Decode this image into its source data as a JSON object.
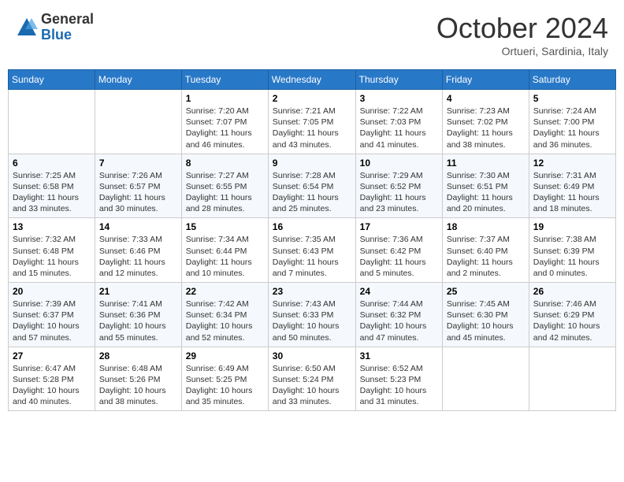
{
  "header": {
    "logo_general": "General",
    "logo_blue": "Blue",
    "month_title": "October 2024",
    "location": "Ortueri, Sardinia, Italy"
  },
  "days_of_week": [
    "Sunday",
    "Monday",
    "Tuesday",
    "Wednesday",
    "Thursday",
    "Friday",
    "Saturday"
  ],
  "weeks": [
    [
      {
        "day": "",
        "sunrise": "",
        "sunset": "",
        "daylight": ""
      },
      {
        "day": "",
        "sunrise": "",
        "sunset": "",
        "daylight": ""
      },
      {
        "day": "1",
        "sunrise": "Sunrise: 7:20 AM",
        "sunset": "Sunset: 7:07 PM",
        "daylight": "Daylight: 11 hours and 46 minutes."
      },
      {
        "day": "2",
        "sunrise": "Sunrise: 7:21 AM",
        "sunset": "Sunset: 7:05 PM",
        "daylight": "Daylight: 11 hours and 43 minutes."
      },
      {
        "day": "3",
        "sunrise": "Sunrise: 7:22 AM",
        "sunset": "Sunset: 7:03 PM",
        "daylight": "Daylight: 11 hours and 41 minutes."
      },
      {
        "day": "4",
        "sunrise": "Sunrise: 7:23 AM",
        "sunset": "Sunset: 7:02 PM",
        "daylight": "Daylight: 11 hours and 38 minutes."
      },
      {
        "day": "5",
        "sunrise": "Sunrise: 7:24 AM",
        "sunset": "Sunset: 7:00 PM",
        "daylight": "Daylight: 11 hours and 36 minutes."
      }
    ],
    [
      {
        "day": "6",
        "sunrise": "Sunrise: 7:25 AM",
        "sunset": "Sunset: 6:58 PM",
        "daylight": "Daylight: 11 hours and 33 minutes."
      },
      {
        "day": "7",
        "sunrise": "Sunrise: 7:26 AM",
        "sunset": "Sunset: 6:57 PM",
        "daylight": "Daylight: 11 hours and 30 minutes."
      },
      {
        "day": "8",
        "sunrise": "Sunrise: 7:27 AM",
        "sunset": "Sunset: 6:55 PM",
        "daylight": "Daylight: 11 hours and 28 minutes."
      },
      {
        "day": "9",
        "sunrise": "Sunrise: 7:28 AM",
        "sunset": "Sunset: 6:54 PM",
        "daylight": "Daylight: 11 hours and 25 minutes."
      },
      {
        "day": "10",
        "sunrise": "Sunrise: 7:29 AM",
        "sunset": "Sunset: 6:52 PM",
        "daylight": "Daylight: 11 hours and 23 minutes."
      },
      {
        "day": "11",
        "sunrise": "Sunrise: 7:30 AM",
        "sunset": "Sunset: 6:51 PM",
        "daylight": "Daylight: 11 hours and 20 minutes."
      },
      {
        "day": "12",
        "sunrise": "Sunrise: 7:31 AM",
        "sunset": "Sunset: 6:49 PM",
        "daylight": "Daylight: 11 hours and 18 minutes."
      }
    ],
    [
      {
        "day": "13",
        "sunrise": "Sunrise: 7:32 AM",
        "sunset": "Sunset: 6:48 PM",
        "daylight": "Daylight: 11 hours and 15 minutes."
      },
      {
        "day": "14",
        "sunrise": "Sunrise: 7:33 AM",
        "sunset": "Sunset: 6:46 PM",
        "daylight": "Daylight: 11 hours and 12 minutes."
      },
      {
        "day": "15",
        "sunrise": "Sunrise: 7:34 AM",
        "sunset": "Sunset: 6:44 PM",
        "daylight": "Daylight: 11 hours and 10 minutes."
      },
      {
        "day": "16",
        "sunrise": "Sunrise: 7:35 AM",
        "sunset": "Sunset: 6:43 PM",
        "daylight": "Daylight: 11 hours and 7 minutes."
      },
      {
        "day": "17",
        "sunrise": "Sunrise: 7:36 AM",
        "sunset": "Sunset: 6:42 PM",
        "daylight": "Daylight: 11 hours and 5 minutes."
      },
      {
        "day": "18",
        "sunrise": "Sunrise: 7:37 AM",
        "sunset": "Sunset: 6:40 PM",
        "daylight": "Daylight: 11 hours and 2 minutes."
      },
      {
        "day": "19",
        "sunrise": "Sunrise: 7:38 AM",
        "sunset": "Sunset: 6:39 PM",
        "daylight": "Daylight: 11 hours and 0 minutes."
      }
    ],
    [
      {
        "day": "20",
        "sunrise": "Sunrise: 7:39 AM",
        "sunset": "Sunset: 6:37 PM",
        "daylight": "Daylight: 10 hours and 57 minutes."
      },
      {
        "day": "21",
        "sunrise": "Sunrise: 7:41 AM",
        "sunset": "Sunset: 6:36 PM",
        "daylight": "Daylight: 10 hours and 55 minutes."
      },
      {
        "day": "22",
        "sunrise": "Sunrise: 7:42 AM",
        "sunset": "Sunset: 6:34 PM",
        "daylight": "Daylight: 10 hours and 52 minutes."
      },
      {
        "day": "23",
        "sunrise": "Sunrise: 7:43 AM",
        "sunset": "Sunset: 6:33 PM",
        "daylight": "Daylight: 10 hours and 50 minutes."
      },
      {
        "day": "24",
        "sunrise": "Sunrise: 7:44 AM",
        "sunset": "Sunset: 6:32 PM",
        "daylight": "Daylight: 10 hours and 47 minutes."
      },
      {
        "day": "25",
        "sunrise": "Sunrise: 7:45 AM",
        "sunset": "Sunset: 6:30 PM",
        "daylight": "Daylight: 10 hours and 45 minutes."
      },
      {
        "day": "26",
        "sunrise": "Sunrise: 7:46 AM",
        "sunset": "Sunset: 6:29 PM",
        "daylight": "Daylight: 10 hours and 42 minutes."
      }
    ],
    [
      {
        "day": "27",
        "sunrise": "Sunrise: 6:47 AM",
        "sunset": "Sunset: 5:28 PM",
        "daylight": "Daylight: 10 hours and 40 minutes."
      },
      {
        "day": "28",
        "sunrise": "Sunrise: 6:48 AM",
        "sunset": "Sunset: 5:26 PM",
        "daylight": "Daylight: 10 hours and 38 minutes."
      },
      {
        "day": "29",
        "sunrise": "Sunrise: 6:49 AM",
        "sunset": "Sunset: 5:25 PM",
        "daylight": "Daylight: 10 hours and 35 minutes."
      },
      {
        "day": "30",
        "sunrise": "Sunrise: 6:50 AM",
        "sunset": "Sunset: 5:24 PM",
        "daylight": "Daylight: 10 hours and 33 minutes."
      },
      {
        "day": "31",
        "sunrise": "Sunrise: 6:52 AM",
        "sunset": "Sunset: 5:23 PM",
        "daylight": "Daylight: 10 hours and 31 minutes."
      },
      {
        "day": "",
        "sunrise": "",
        "sunset": "",
        "daylight": ""
      },
      {
        "day": "",
        "sunrise": "",
        "sunset": "",
        "daylight": ""
      }
    ]
  ]
}
